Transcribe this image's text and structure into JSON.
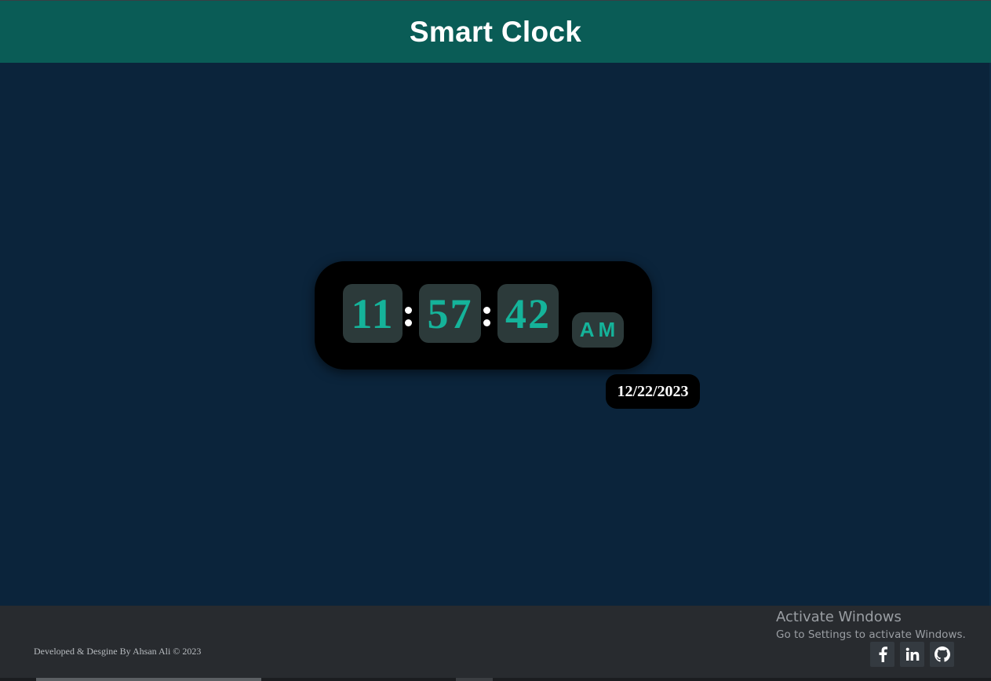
{
  "header": {
    "title": "Smart Clock",
    "background": "#0a5c56"
  },
  "clock": {
    "hours": "11",
    "minutes": "57",
    "seconds": "42",
    "period": "AM",
    "date": "12/22/2023",
    "digit_color": "#15b39a"
  },
  "footer": {
    "credit": "Developed & Desgine By Ahsan Ali © 2023",
    "social_icons": [
      "facebook-icon",
      "linkedin-icon",
      "github-icon"
    ]
  },
  "watermark": {
    "title": "Activate Windows",
    "subtitle": "Go to Settings to activate Windows."
  },
  "colors": {
    "page_background": "#0b243b",
    "footer_background": "#282b2f",
    "clock_background": "#000000",
    "digit_box": "#2c3a3a"
  }
}
